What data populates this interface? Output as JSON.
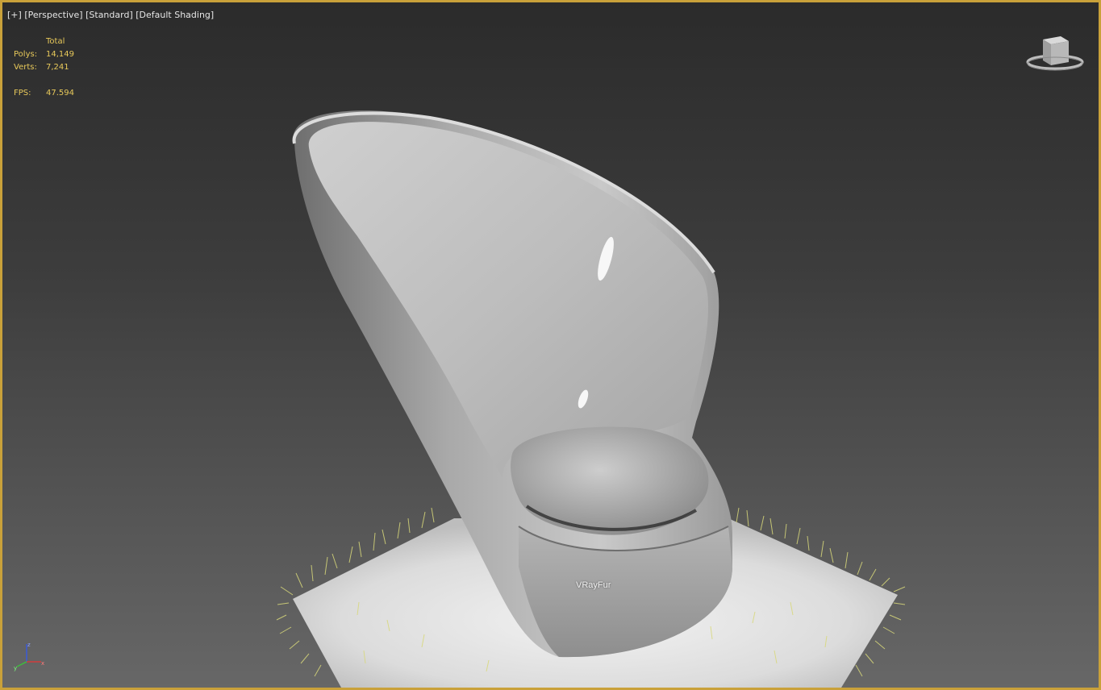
{
  "viewport": {
    "label_parts": [
      "[+]",
      "[Perspective]",
      "[Standard]",
      "[Default Shading]"
    ]
  },
  "stats": {
    "total_header": "Total",
    "polys_label": "Polys:",
    "polys_value": "14,149",
    "verts_label": "Verts:",
    "verts_value": "7,241",
    "fps_label": "FPS:",
    "fps_value": "47.594"
  },
  "scene": {
    "object_label": "VRayFur"
  },
  "icons": {
    "viewcube": "viewcube-icon",
    "axis_tripod": "axis-tripod-icon"
  },
  "colors": {
    "viewport_border": "#c9a13a",
    "stats_text": "#e8c95a",
    "fur_strands": "#d8d87a"
  }
}
